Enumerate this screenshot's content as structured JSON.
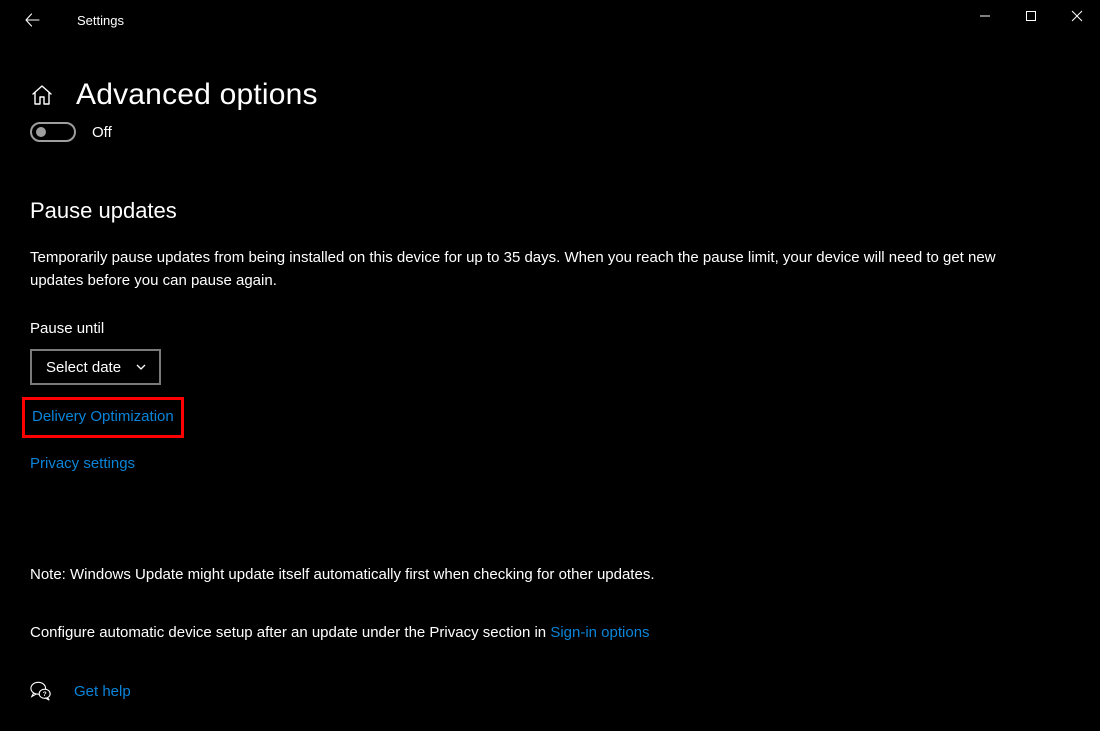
{
  "titlebar": {
    "app_title": "Settings"
  },
  "page": {
    "title": "Advanced options",
    "toggle_state_label": "Off"
  },
  "pause_section": {
    "heading": "Pause updates",
    "description": "Temporarily pause updates from being installed on this device for up to 35 days. When you reach the pause limit, your device will need to get new updates before you can pause again.",
    "field_label": "Pause until",
    "select_label": "Select date"
  },
  "links": {
    "delivery_optimization": "Delivery Optimization",
    "privacy_settings": "Privacy settings",
    "signin_options": "Sign-in options",
    "get_help": "Get help"
  },
  "notes": {
    "windows_update_note": "Note: Windows Update might update itself automatically first when checking for other updates.",
    "configure_prefix": "Configure automatic device setup after an update under the Privacy section in "
  }
}
